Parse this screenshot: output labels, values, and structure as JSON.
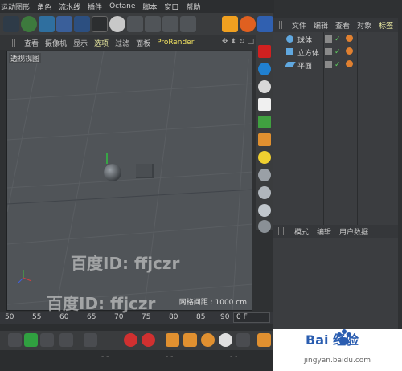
{
  "menubar": {
    "items": [
      "运动图形",
      "角色",
      "流水线",
      "插件",
      "Octane",
      "脚本",
      "窗口",
      "帮助"
    ]
  },
  "viewport": {
    "menu": [
      "查看",
      "摄像机",
      "显示",
      "选项",
      "过滤",
      "面板",
      "ProRender"
    ],
    "label": "透视视图",
    "grid_info": "网格间距 : 1000 cm"
  },
  "object_manager": {
    "menu": [
      "文件",
      "编辑",
      "查看",
      "对象",
      "标签"
    ],
    "objects": [
      {
        "name": "球体"
      },
      {
        "name": "立方体"
      },
      {
        "name": "平面"
      }
    ]
  },
  "attribute_manager": {
    "menu": [
      "模式",
      "编辑",
      "用户数据"
    ]
  },
  "timeline": {
    "ticks": [
      "50",
      "55",
      "60",
      "65",
      "70",
      "75",
      "80",
      "85",
      "90"
    ],
    "frame": "0 F"
  },
  "watermark": {
    "text": "百度ID: ffjczr"
  },
  "baidu": {
    "logo": "Bai  经验",
    "url": "jingyan.baidu.com"
  },
  "colors": {
    "accent_orange": "#f0a020",
    "panel_bg": "#3b3d40",
    "viewport_bg": "#505458"
  }
}
